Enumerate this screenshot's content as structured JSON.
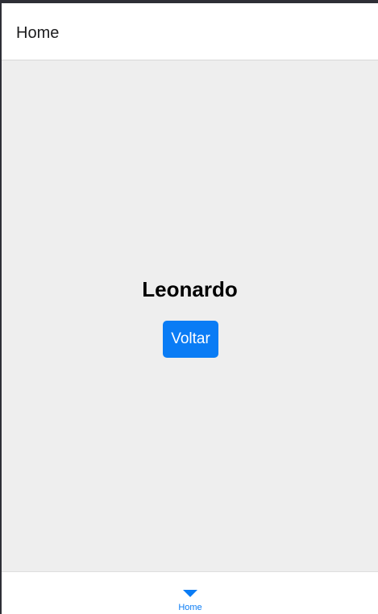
{
  "header": {
    "title": "Home"
  },
  "main": {
    "name": "Leonardo",
    "back_button_label": "Voltar"
  },
  "tabbar": {
    "items": [
      {
        "label": "Home",
        "icon": "triangle-down-icon",
        "active": true,
        "color": "#0a7cf5"
      }
    ]
  },
  "colors": {
    "accent": "#0a7cf5",
    "content_background": "#eeeeee"
  }
}
